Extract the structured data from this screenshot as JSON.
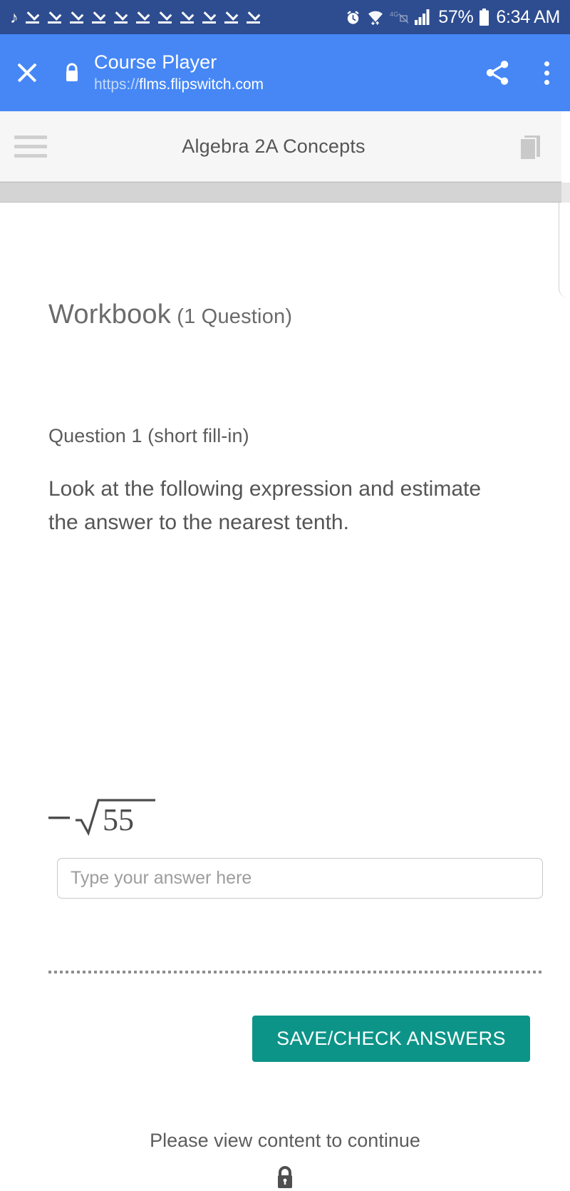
{
  "status_bar": {
    "music_icon": "music-note-icon",
    "download_icons": [
      "download-complete-icon",
      "download-complete-icon",
      "download-complete-icon",
      "download-complete-icon",
      "download-complete-icon",
      "download-complete-icon",
      "download-complete-icon",
      "download-complete-icon",
      "download-complete-icon",
      "download-complete-icon",
      "download-complete-icon"
    ],
    "alarm_icon": "alarm-clock-icon",
    "wifi_icon": "wifi-icon",
    "network_icon": "4g-network-icon",
    "signal_icon": "cellular-signal-icon",
    "battery_percent": "57%",
    "battery_icon": "battery-icon",
    "time": "6:34 AM",
    "background_color": "#2e4d90"
  },
  "browser_bar": {
    "close_icon": "close-icon",
    "lock_icon": "lock-icon",
    "title": "Course Player",
    "url_scheme": "https://",
    "url_host": "flms.flipswitch.com",
    "share_icon": "share-icon",
    "overflow_icon": "overflow-menu-icon",
    "background_color": "#4687f5"
  },
  "app_header": {
    "menu_icon": "hamburger-menu-icon",
    "course_title": "Algebra 2A Concepts",
    "book_icon": "book-icon"
  },
  "workbook": {
    "title": "Workbook",
    "count": " (1 Question)",
    "question_label": "Question 1 (short fill-in)",
    "prompt": "Look at the following expression and estimate the answer to the nearest tenth.",
    "expression_text": "−√55",
    "expression_radicand": "55",
    "answer_placeholder": "Type your answer here",
    "answer_value": "",
    "save_button_label": "SAVE/CHECK ANSWERS",
    "button_color": "#0d9488"
  },
  "footer": {
    "message": "Please view content to continue",
    "lock_icon": "lock-icon"
  }
}
